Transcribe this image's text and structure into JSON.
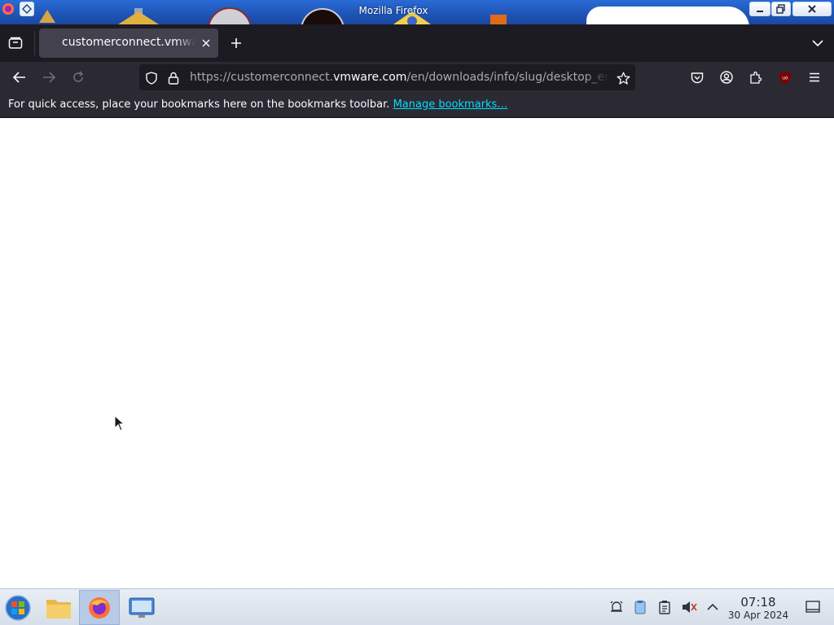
{
  "window": {
    "title": "Mozilla Firefox"
  },
  "tabs": [
    {
      "title": "customerconnect.vmware.com/en/downloads/info/slug/desktop_end_user_computing",
      "close_icon": "close-icon"
    }
  ],
  "nav": {
    "url_prefix": "https://customerconnect.",
    "url_host": "vmware.com",
    "url_path": "/en/downloads/info/slug/desktop_end_user_computing"
  },
  "bookmarks_bar": {
    "message": "For quick access, place your bookmarks here on the bookmarks toolbar.",
    "link": "Manage bookmarks…"
  },
  "taskbar": {
    "time": "07:18",
    "date": "30 Apr 2024"
  },
  "colors": {
    "tabstrip_bg": "#1c1b22",
    "toolbar_bg": "#2b2a33",
    "tab_active": "#42414d",
    "link": "#00ddff",
    "titlebar": "#1f56b8"
  }
}
